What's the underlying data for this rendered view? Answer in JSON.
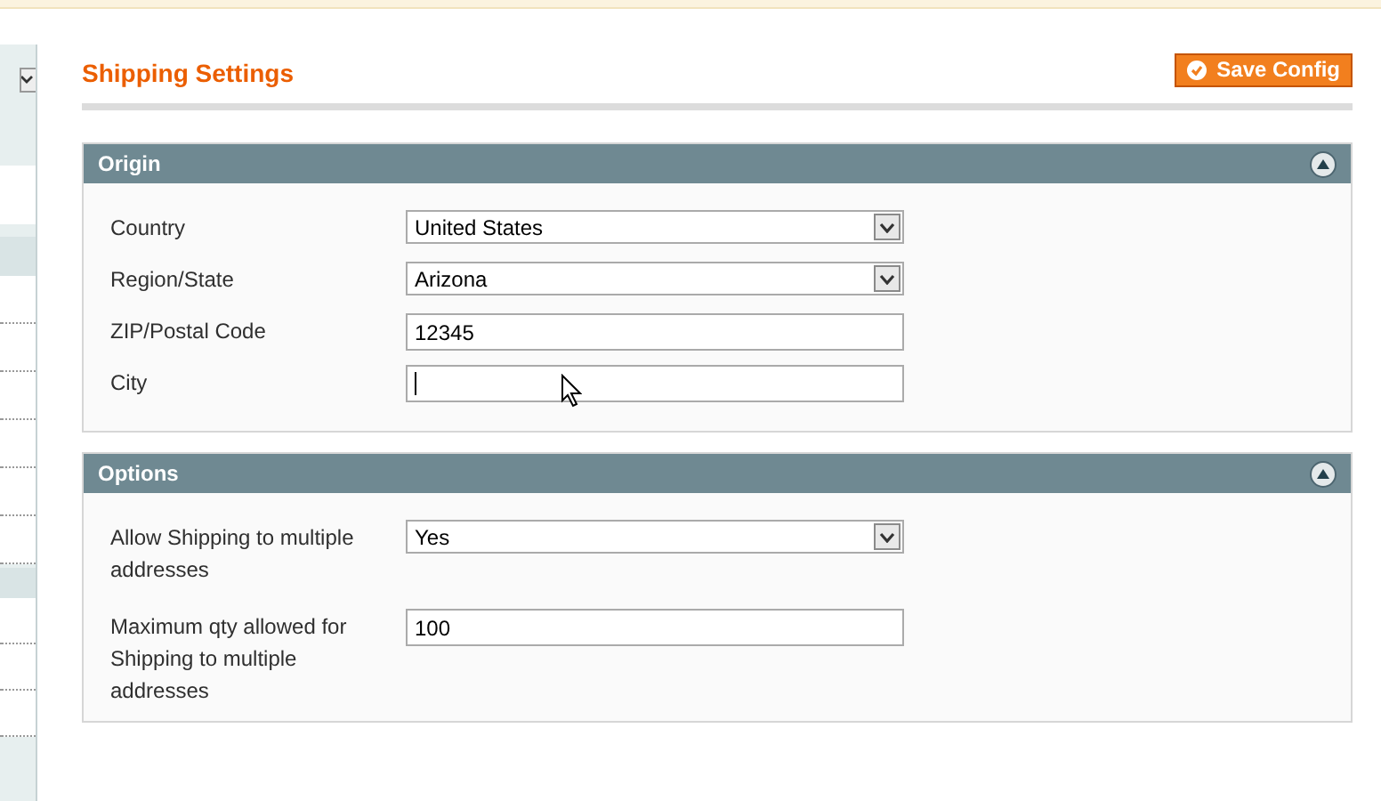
{
  "page": {
    "title": "Shipping Settings",
    "save_button": "Save Config"
  },
  "sections": [
    {
      "title": "Origin",
      "expanded": true,
      "fields": [
        {
          "label": "Country",
          "kind": "select",
          "value": "United States"
        },
        {
          "label": "Region/State",
          "kind": "select",
          "value": "Arizona"
        },
        {
          "label": "ZIP/Postal Code",
          "kind": "text",
          "value": "12345"
        },
        {
          "label": "City",
          "kind": "text",
          "focused": true
        }
      ]
    },
    {
      "title": "Options",
      "expanded": true,
      "fields": [
        {
          "label": "Allow Shipping to multiple addresses",
          "kind": "select",
          "value": "Yes"
        },
        {
          "label": "Maximum qty allowed for Shipping to multiple addresses",
          "kind": "text",
          "value": "100"
        }
      ]
    }
  ]
}
